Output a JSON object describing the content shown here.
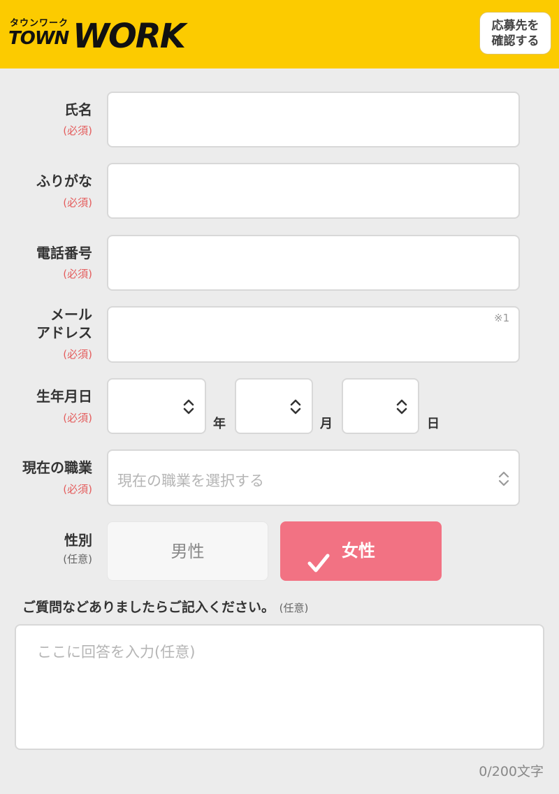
{
  "header": {
    "logo_kana": "タウンワーク",
    "logo_town": "TOWN",
    "logo_work": "WORK",
    "confirm_button": "応募先を\n確認する",
    "bg_color": "#fccb00"
  },
  "form": {
    "required_mark": "(必須)",
    "optional_mark": "(任意)",
    "name": {
      "label": "氏名",
      "value": ""
    },
    "furigana": {
      "label": "ふりがな",
      "value": ""
    },
    "phone": {
      "label": "電話番号",
      "value": ""
    },
    "email": {
      "label": "メール\nアドレス",
      "value": "",
      "note": "※1"
    },
    "birthdate": {
      "label": "生年月日",
      "year_unit": "年",
      "month_unit": "月",
      "day_unit": "日",
      "year_value": "",
      "month_value": "",
      "day_value": ""
    },
    "occupation": {
      "label": "現在の職業",
      "placeholder": "現在の職業を選択する"
    },
    "gender": {
      "label": "性別",
      "options": [
        "男性",
        "女性"
      ],
      "selected": "女性",
      "selected_color": "#f27283"
    },
    "question": {
      "label": "ご質問などありましたらご記入ください。",
      "optional": "(任意)",
      "placeholder": "ここに回答を入力(任意)",
      "counter": "0/200文字"
    }
  },
  "icons": [
    "check-icon",
    "chevron-updown-icon"
  ]
}
